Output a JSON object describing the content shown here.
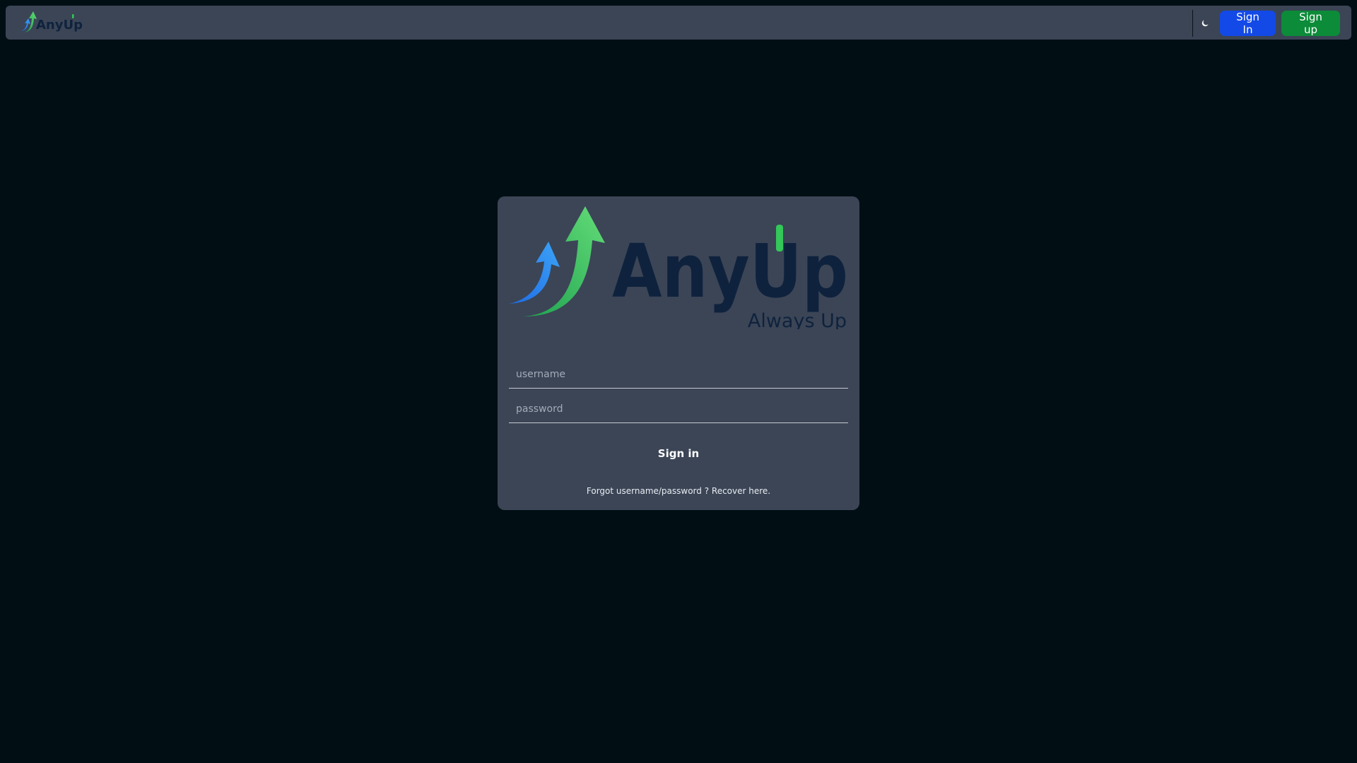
{
  "navbar": {
    "logo_alt": "AnyUp",
    "signin_label": "Sign In",
    "signup_label": "Sign up",
    "theme_icon": "moon-icon"
  },
  "login": {
    "brand_name": "AnyUp",
    "tagline": "Always Up",
    "username_placeholder": "username",
    "password_placeholder": "password",
    "submit_label": "Sign in",
    "recover_text": "Forgot username/password ? Recover here."
  },
  "colors": {
    "page_bg": "#010e14",
    "panel_bg": "#3b4556",
    "brand_navy": "#0f223d",
    "brand_green": "#34c759",
    "brand_blue": "#2d8cf0",
    "signin_button": "#1349e6",
    "signup_button": "#0c8b39"
  }
}
